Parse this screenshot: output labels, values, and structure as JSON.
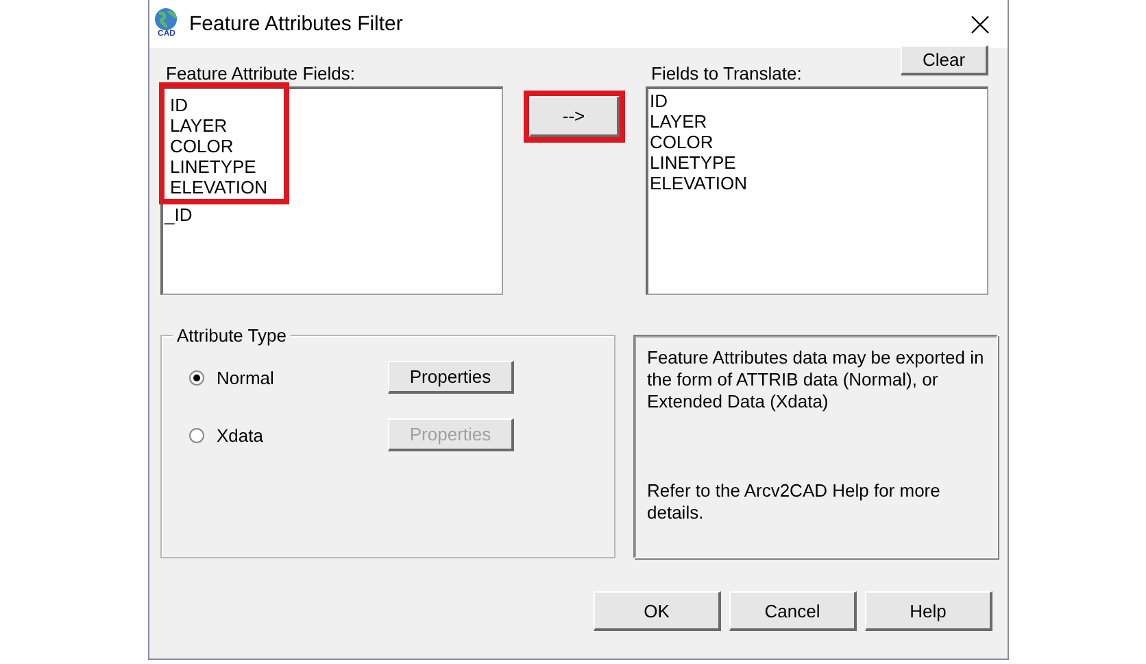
{
  "window": {
    "title": "Feature Attributes Filter",
    "app_icon_text": "CAD"
  },
  "available_fields": {
    "label": "Feature Attribute Fields:",
    "items": [
      {
        "text": "ID",
        "highlighted": true
      },
      {
        "text": "LAYER",
        "highlighted": true
      },
      {
        "text": "COLOR",
        "highlighted": true
      },
      {
        "text": "LINETYPE",
        "highlighted": true
      },
      {
        "text": "ELEVATION",
        "highlighted": true
      },
      {
        "text": "_ID",
        "highlighted": false
      }
    ]
  },
  "add_button": {
    "label": "-->",
    "highlighted": true
  },
  "translate_fields": {
    "label": "Fields to Translate:",
    "clear_button": "Clear",
    "items": [
      "ID",
      "LAYER",
      "COLOR",
      "LINETYPE",
      "ELEVATION"
    ]
  },
  "attribute_type": {
    "title": "Attribute Type",
    "options": [
      {
        "label": "Normal",
        "selected": true,
        "button": {
          "label": "Properties",
          "disabled": false
        }
      },
      {
        "label": "Xdata",
        "selected": false,
        "button": {
          "label": "Properties",
          "disabled": true
        }
      }
    ]
  },
  "info": {
    "paragraphs": [
      "Feature Attributes data may be exported in the form of ATTRIB data (Normal), or Extended Data (Xdata)",
      "Refer to the Arcv2CAD Help for more details."
    ]
  },
  "buttons": [
    "OK",
    "Cancel",
    "Help"
  ]
}
